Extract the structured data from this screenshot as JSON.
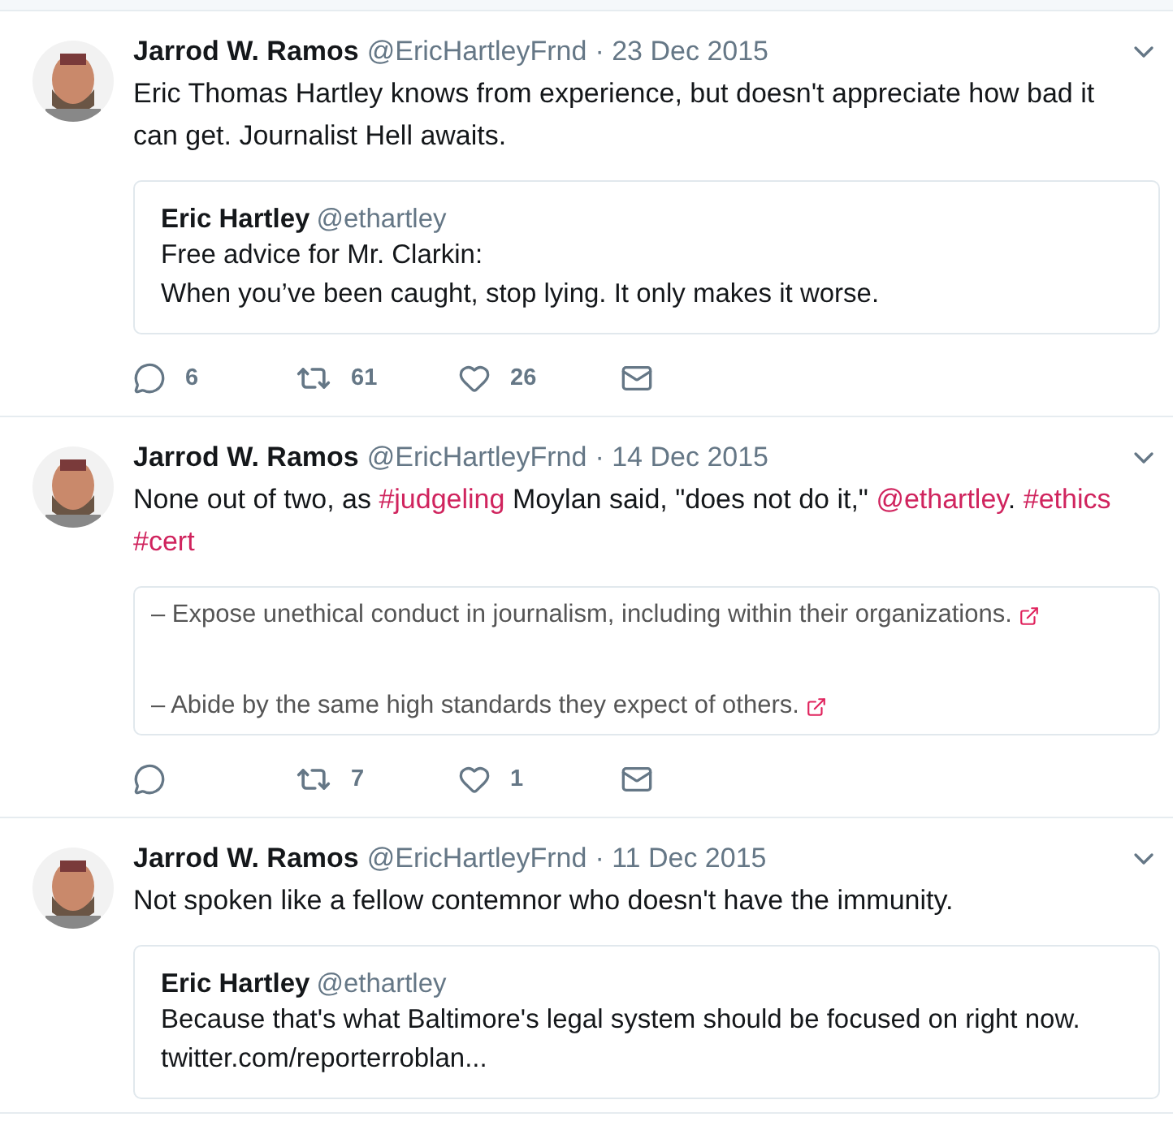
{
  "tweets": [
    {
      "name": "Jarrod W. Ramos",
      "handle": "@EricHartleyFrnd",
      "date": "· 23 Dec 2015",
      "text": [
        {
          "kind": "text",
          "value": "Eric Thomas Hartley knows from experience, but doesn't appreciate how bad it can get. Journalist Hell awaits."
        }
      ],
      "card": {
        "kind": "quote",
        "name": "Eric Hartley",
        "handle": "@ethartley",
        "lines": [
          "Free advice for Mr. Clarkin:",
          "When you’ve been caught, stop lying. It only makes it worse."
        ]
      },
      "actions": {
        "replies": "6",
        "retweets": "61",
        "likes": "26"
      }
    },
    {
      "name": "Jarrod W. Ramos",
      "handle": "@EricHartleyFrnd",
      "date": "· 14 Dec 2015",
      "text": [
        {
          "kind": "text",
          "value": "None out of two, as "
        },
        {
          "kind": "link",
          "value": "#judgeling"
        },
        {
          "kind": "text",
          "value": " Moylan said, \"does not do it,\" "
        },
        {
          "kind": "link",
          "value": "@ethartley"
        },
        {
          "kind": "text",
          "value": ". "
        },
        {
          "kind": "link",
          "value": "#ethics"
        },
        {
          "kind": "link",
          "value": "#cert"
        }
      ],
      "card": {
        "kind": "preview",
        "lines": [
          "– Expose unethical conduct in journalism, including within their organizations.",
          "– Abide by the same high standards they expect of others."
        ]
      },
      "actions": {
        "retweets": "7",
        "likes": "1"
      }
    },
    {
      "name": "Jarrod W. Ramos",
      "handle": "@EricHartleyFrnd",
      "date": "· 11 Dec 2015",
      "text": [
        {
          "kind": "text",
          "value": "Not spoken like a fellow contemnor who doesn't have the immunity."
        }
      ],
      "card": {
        "kind": "quote",
        "name": "Eric Hartley",
        "handle": "@ethartley",
        "lines": [
          "Because that's what Baltimore's legal system should be focused on right now.",
          "twitter.com/reporterroblan..."
        ]
      }
    }
  ]
}
